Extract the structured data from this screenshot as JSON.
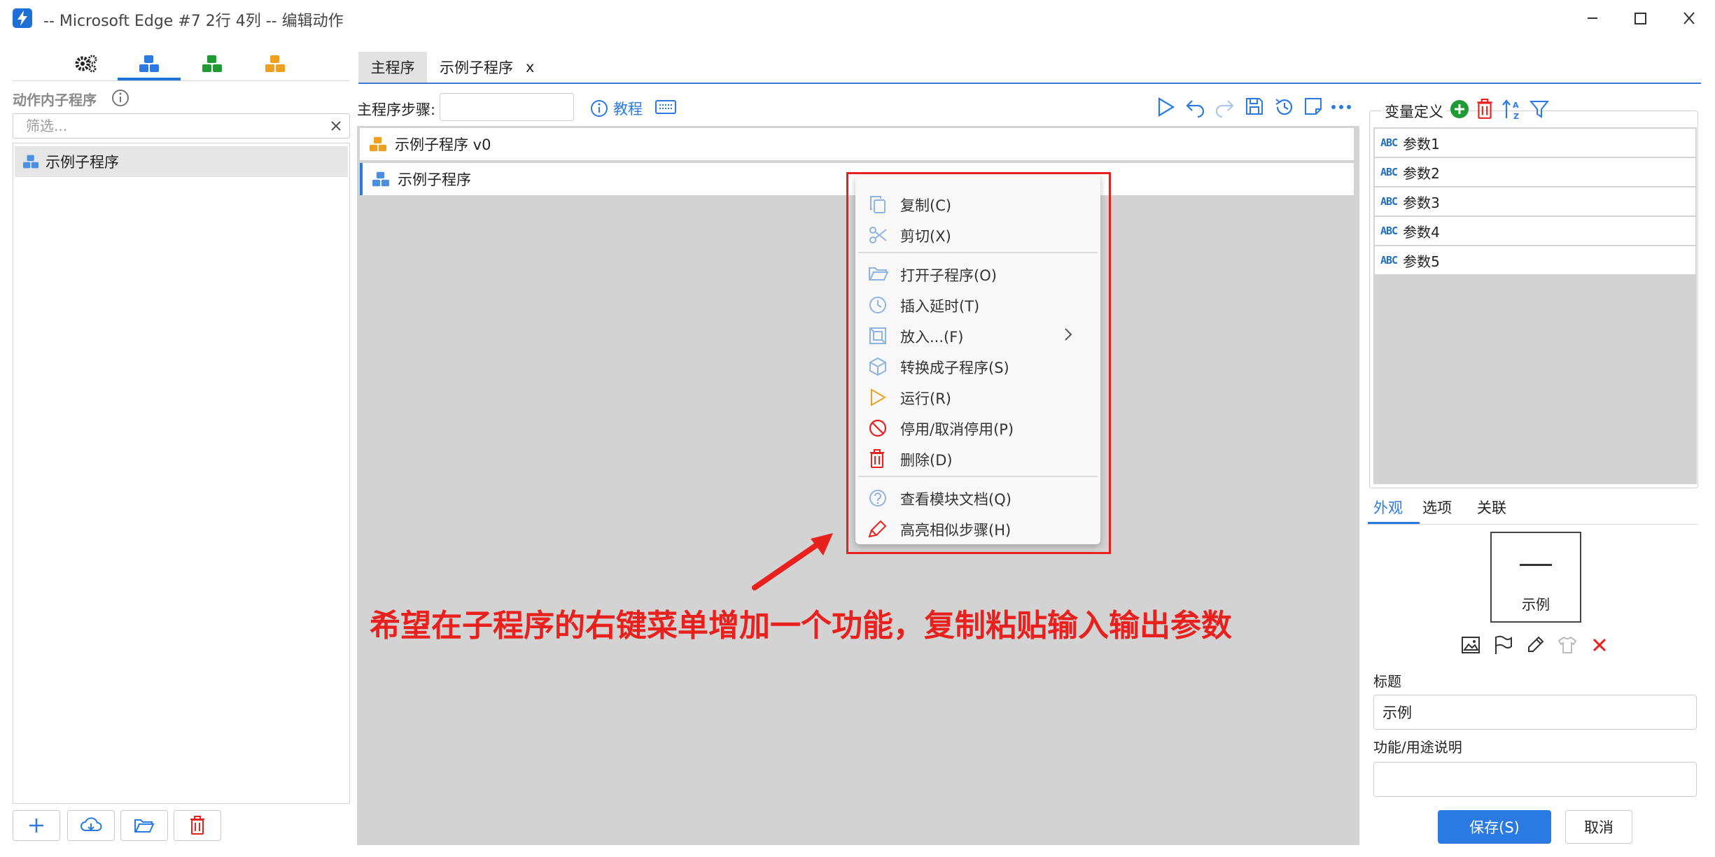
{
  "window": {
    "title": "-- Microsoft Edge #7 2行 4列 -- 编辑动作",
    "controls": [
      "minimize-icon",
      "maximize-icon",
      "close-icon"
    ]
  },
  "left_panel": {
    "tabs": [
      {
        "icon": "gears-icon",
        "color": "#222222"
      },
      {
        "icon": "blue-blocks-icon",
        "color": "#2a7ae2",
        "active": true
      },
      {
        "icon": "green-blocks-icon",
        "color": "#1e9b33"
      },
      {
        "icon": "orange-blocks-icon",
        "color": "#f0a020"
      }
    ],
    "title": "动作内子程序",
    "filter_placeholder": "筛选...",
    "items": [
      {
        "label": "示例子程序"
      }
    ],
    "bottom_buttons": [
      "add-icon",
      "cloud-download-icon",
      "folder-open-icon",
      "trash-icon"
    ]
  },
  "center": {
    "tabs": [
      {
        "label": "主程序",
        "active": true
      },
      {
        "label": "示例子程序",
        "close": "x"
      }
    ],
    "steps_label": "主程序步骤:",
    "tutorial_label": "教程",
    "steps": [
      {
        "label": "示例子程序 v0",
        "icon_color": "#f0a020"
      },
      {
        "label": "示例子程序",
        "icon_color": "#2a7ae2",
        "selected": true
      }
    ]
  },
  "context_menu": {
    "items": [
      {
        "label": "复制(C)",
        "icon": "copy-icon"
      },
      {
        "label": "剪切(X)",
        "icon": "scissors-icon"
      },
      {
        "label": "打开子程序(O)",
        "icon": "folder-open-icon"
      },
      {
        "label": "插入延时(T)",
        "icon": "clock-icon"
      },
      {
        "label": "放入...(F)",
        "icon": "frame-icon",
        "submenu": true
      },
      {
        "label": "转换成子程序(S)",
        "icon": "cube-icon"
      },
      {
        "label": "运行(R)",
        "icon": "play-icon"
      },
      {
        "label": "停用/取消停用(P)",
        "icon": "ban-icon"
      },
      {
        "label": "删除(D)",
        "icon": "trash-icon"
      },
      {
        "label": "查看模块文档(Q)",
        "icon": "help-icon"
      },
      {
        "label": "高亮相似步骤(H)",
        "icon": "highlighter-icon"
      }
    ]
  },
  "annotation": {
    "text": "希望在子程序的右键菜单增加一个功能，复制粘贴输入输出参数",
    "color": "#e8211e"
  },
  "right_panel": {
    "var_title": "变量定义",
    "variables": [
      {
        "type": "ABC",
        "name": "参数1"
      },
      {
        "type": "ABC",
        "name": "参数2"
      },
      {
        "type": "ABC",
        "name": "参数3"
      },
      {
        "type": "ABC",
        "name": "参数4"
      },
      {
        "type": "ABC",
        "name": "参数5"
      }
    ],
    "tabs": [
      {
        "label": "外观",
        "active": true
      },
      {
        "label": "选项"
      },
      {
        "label": "关联"
      }
    ],
    "preview_label": "示例",
    "title_label": "标题",
    "title_value": "示例",
    "desc_label": "功能/用途说明",
    "desc_value": "",
    "save_label": "保存(S)",
    "cancel_label": "取消"
  }
}
